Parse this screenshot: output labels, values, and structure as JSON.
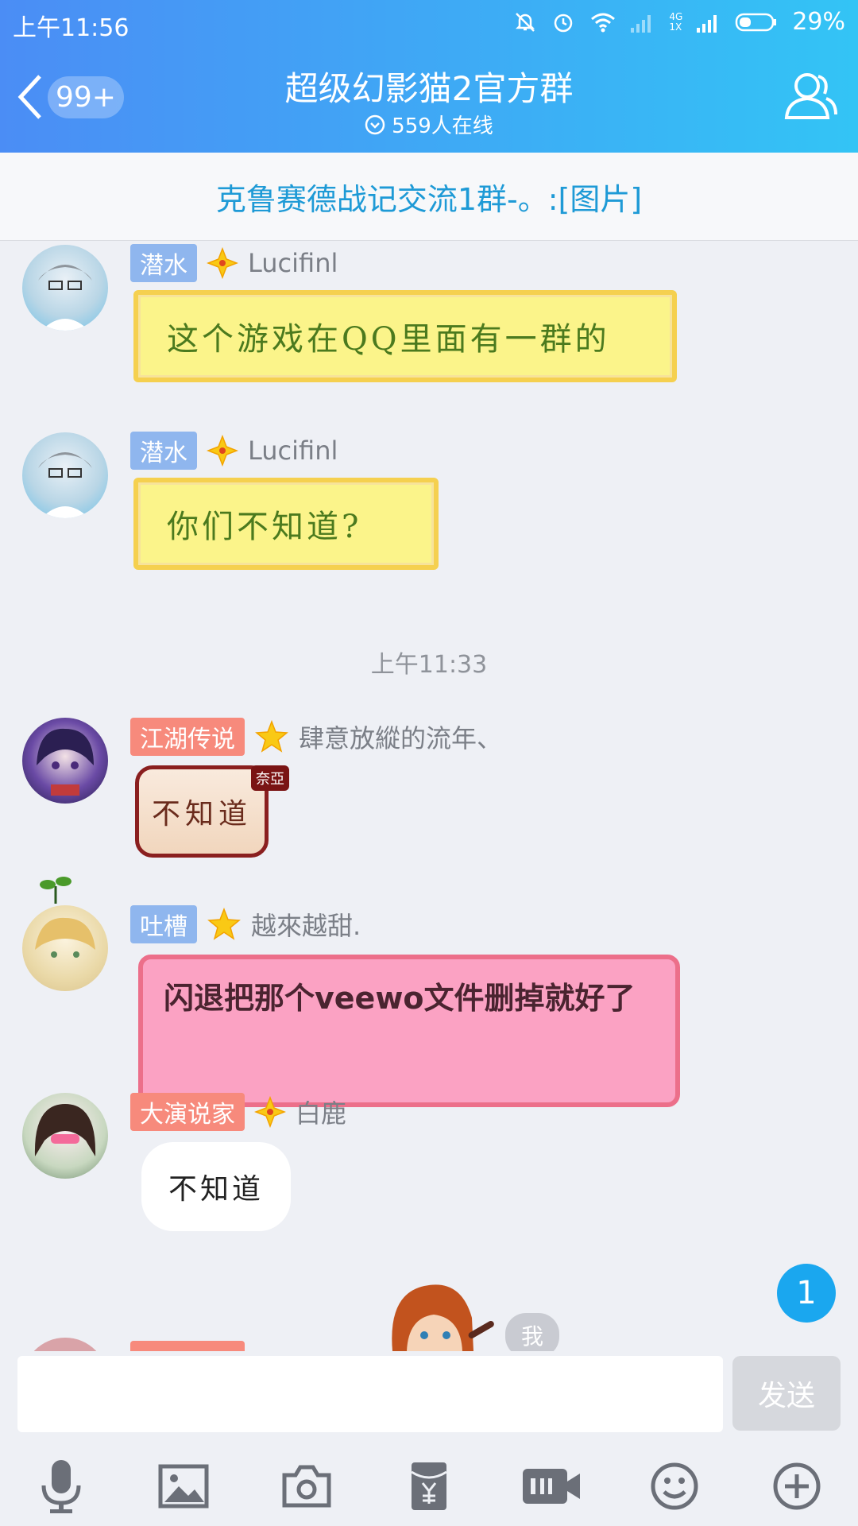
{
  "status_bar": {
    "time": "上午11:56",
    "network": "4G\n1X",
    "battery": "29%"
  },
  "header": {
    "back_badge": "99+",
    "title": "超级幻影猫2官方群",
    "online": "559人在线"
  },
  "notice": "克鲁赛德战记交流1群-。:[图片]",
  "messages": [
    {
      "level": "潜水",
      "name": "Lucifinl",
      "text": "这个游戏在QQ里面有一群的"
    },
    {
      "level": "潜水",
      "name": "Lucifinl",
      "text": "你们不知道?"
    },
    {
      "level": "江湖传说",
      "name": "肆意放縱的流年、",
      "text": "不知道",
      "sticker_tag": "奈亞"
    },
    {
      "level": "吐槽",
      "name": "越來越甜.",
      "text": "闪退把那个veewo文件删掉就好了"
    },
    {
      "level": "大演说家",
      "name": "白鹿",
      "text": "不知道"
    }
  ],
  "timestamp": "上午11:33",
  "new_message_count": "1",
  "me_tag": "我",
  "input": {
    "placeholder": "",
    "send_label": "发送"
  },
  "colors": {
    "header_start": "#4b8df5",
    "header_end": "#33c4f5",
    "accent": "#1aa7ef"
  },
  "toolbar_icons": [
    "microphone-icon",
    "image-icon",
    "camera-icon",
    "red-packet-icon",
    "gif-icon",
    "emoji-icon",
    "plus-icon"
  ]
}
